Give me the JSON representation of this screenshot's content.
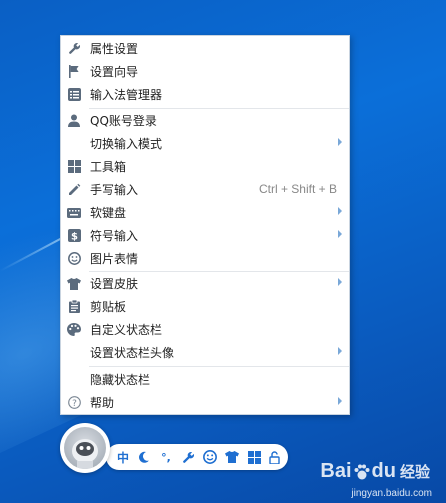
{
  "menu": {
    "items": [
      {
        "label": "属性设置",
        "icon": "wrench-icon"
      },
      {
        "label": "设置向导",
        "icon": "flag-icon"
      },
      {
        "label": "输入法管理器",
        "icon": "list-icon"
      },
      {
        "label": "QQ账号登录",
        "icon": "user-icon"
      },
      {
        "label": "切换输入模式",
        "icon": "",
        "submenu": true
      },
      {
        "label": "工具箱",
        "icon": "grid-icon"
      },
      {
        "label": "手写输入",
        "icon": "pencil-icon",
        "shortcut": "Ctrl + Shift + B"
      },
      {
        "label": "软键盘",
        "icon": "keyboard-icon",
        "submenu": true
      },
      {
        "label": "符号输入",
        "icon": "dollar-icon",
        "submenu": true
      },
      {
        "label": "图片表情",
        "icon": "smiley-icon"
      },
      {
        "label": "设置皮肤",
        "icon": "shirt-icon",
        "submenu": true
      },
      {
        "label": "剪贴板",
        "icon": "clipboard-icon"
      },
      {
        "label": "自定义状态栏",
        "icon": "palette-icon"
      },
      {
        "label": "设置状态栏头像",
        "icon": "",
        "submenu": true
      },
      {
        "label": "隐藏状态栏",
        "icon": ""
      },
      {
        "label": "帮助",
        "icon": "help-icon",
        "submenu": true
      }
    ]
  },
  "statusbar": {
    "mode_label": "中",
    "punct_label": "°,",
    "icons": [
      "moon-icon",
      "wrench-icon",
      "smiley-icon",
      "shirt-icon",
      "grid-icon",
      "lock-icon"
    ]
  },
  "watermark": {
    "brand": "Bai",
    "brand_suffix": "du",
    "cn": "经验",
    "url": "jingyan.baidu.com"
  },
  "colors": {
    "accent": "#1f6fd1",
    "desktop": "#0b6fd9"
  }
}
